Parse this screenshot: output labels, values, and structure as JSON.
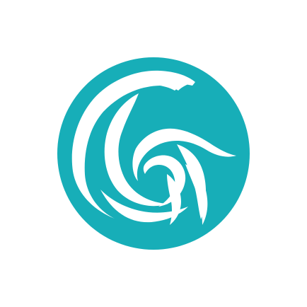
{
  "logo": {
    "icon": "wave-bird-logo-icon",
    "colors": {
      "background": "#ffffff",
      "circle": "#17aeb8",
      "mark": "#ffffff"
    }
  }
}
